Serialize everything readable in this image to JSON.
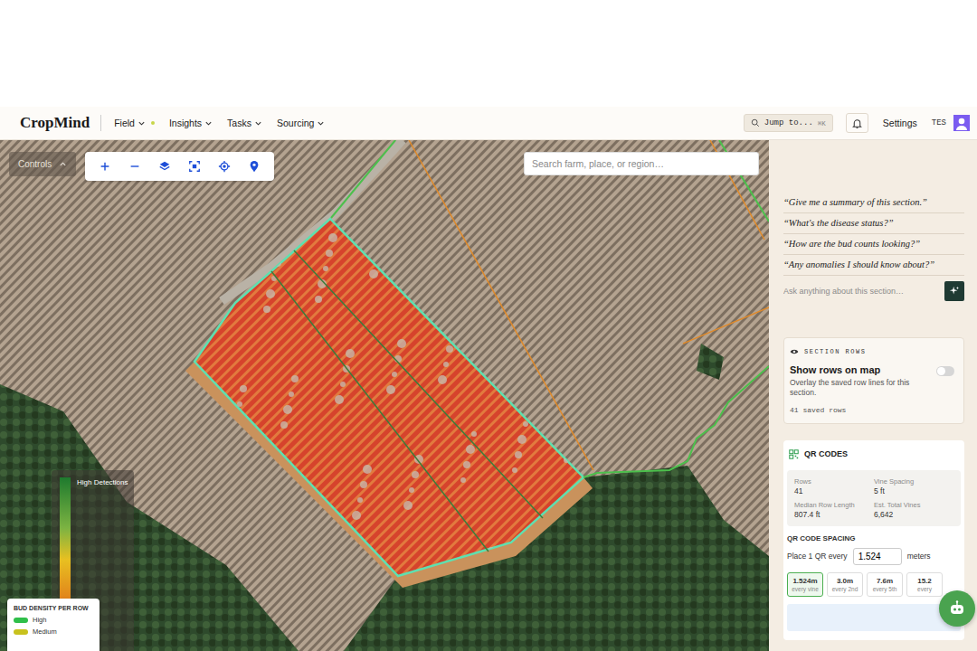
{
  "nav": {
    "logo": "CropMind",
    "menus": [
      {
        "label": "Field",
        "badge": true
      },
      {
        "label": "Insights",
        "badge": false
      },
      {
        "label": "Tasks",
        "badge": false
      },
      {
        "label": "Sourcing",
        "badge": false
      }
    ],
    "jump": {
      "placeholder": "Jump to...",
      "shortcut": "⌘K"
    },
    "settings": "Settings",
    "user": "TES"
  },
  "map": {
    "controls": {
      "label": "Controls",
      "expanded": true
    },
    "search": {
      "placeholder": "Search farm, place, or region…"
    },
    "heat_legend": {
      "title": "High Detections"
    },
    "bud_legend": {
      "title": "BUD DENSITY PER ROW",
      "items": [
        {
          "label": "High",
          "color": "#2fbf4a"
        },
        {
          "label": "Medium",
          "color": "#c8c21e"
        }
      ]
    }
  },
  "assistant": {
    "suggestions": [
      "“Give me a summary of this section.”",
      "“What's the disease status?”",
      "“How are the bud counts looking?”",
      "“Any anomalies I should know about?”"
    ],
    "input": {
      "placeholder": "Ask anything about this section…"
    }
  },
  "section_rows": {
    "title": "SECTION ROWS",
    "heading": "Show rows on map",
    "description": "Overlay the saved row lines for this section.",
    "count": "41 saved rows",
    "on": false
  },
  "qr": {
    "title": "QR CODES",
    "stats": [
      {
        "label": "Rows",
        "value": "41"
      },
      {
        "label": "Vine Spacing",
        "value": "5 ft"
      },
      {
        "label": "Median Row Length",
        "value": "807.4 ft"
      },
      {
        "label": "Est. Total Vines",
        "value": "6,642"
      }
    ],
    "spacing_title": "QR CODE SPACING",
    "place_prefix": "Place 1 QR every",
    "value": "1.524",
    "unit": "meters",
    "presets": [
      {
        "value": "1.524m",
        "note": "every vine",
        "selected": true
      },
      {
        "value": "3.0m",
        "note": "every 2nd",
        "selected": false
      },
      {
        "value": "7.6m",
        "note": "every 5th",
        "selected": false
      },
      {
        "value": "15.2",
        "note": "every",
        "selected": false
      }
    ]
  }
}
